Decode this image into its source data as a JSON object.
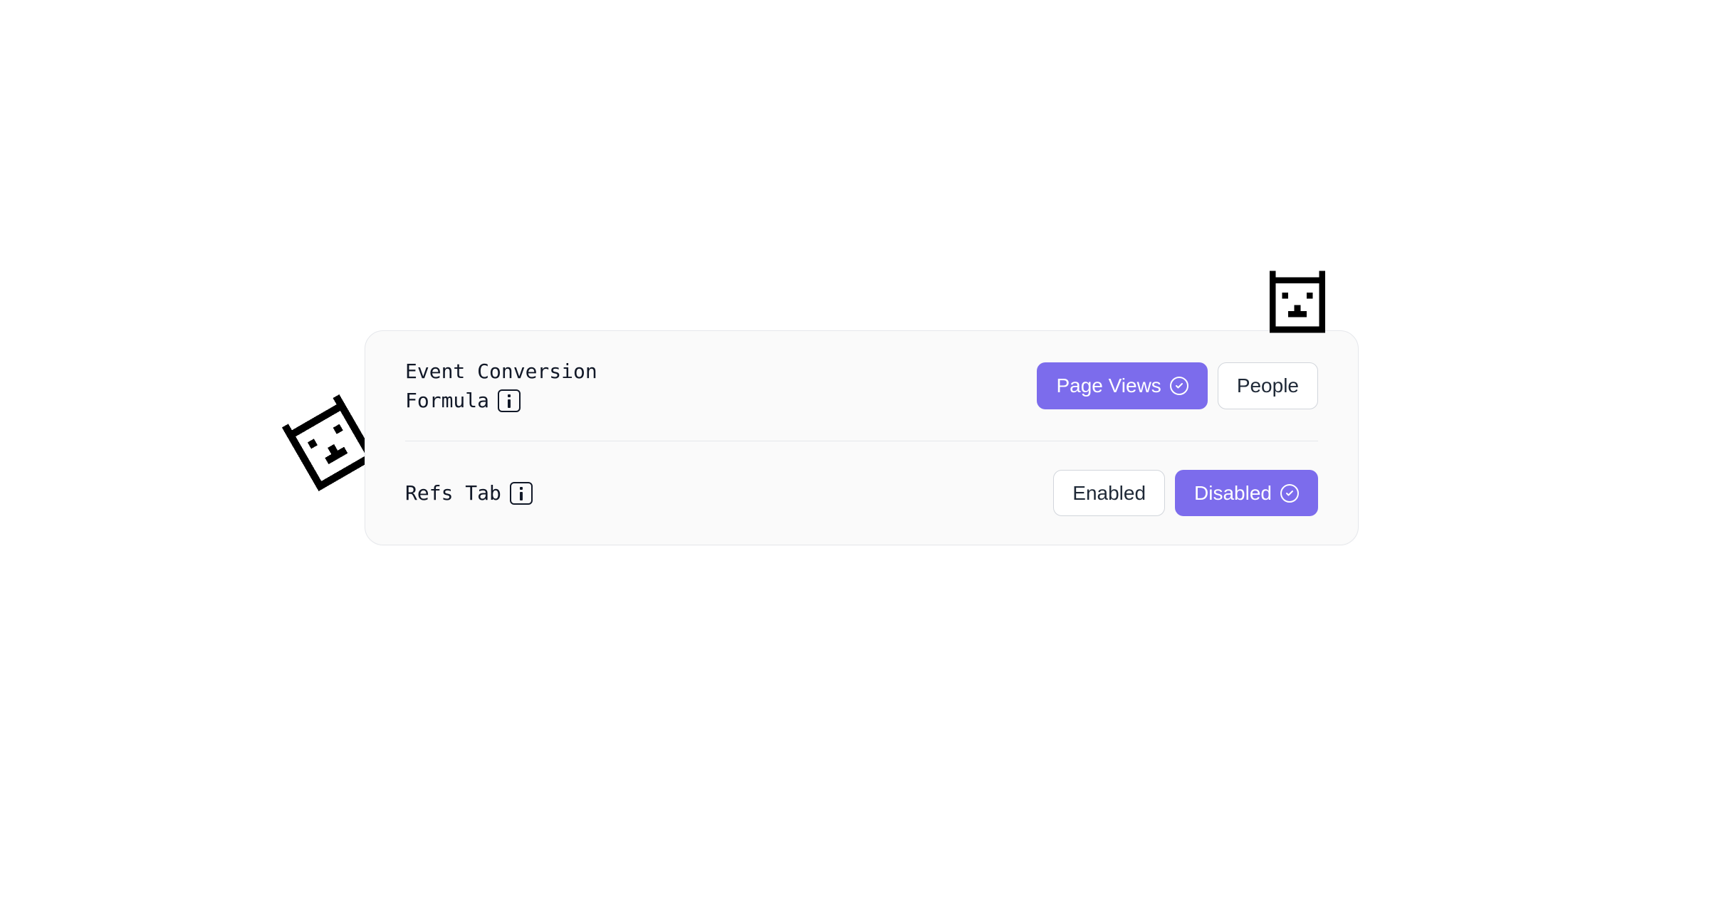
{
  "settings": {
    "rows": [
      {
        "label_line1": "Event Conversion",
        "label_line2": "Formula",
        "option1": "Page Views",
        "option2": "People",
        "selected": 0
      },
      {
        "label_line1": "Refs Tab",
        "option1": "Enabled",
        "option2": "Disabled",
        "selected": 1
      }
    ]
  },
  "colors": {
    "primary": "#7c6cec",
    "card_bg": "#fafafa",
    "border": "#e5e7eb",
    "text": "#111827"
  }
}
